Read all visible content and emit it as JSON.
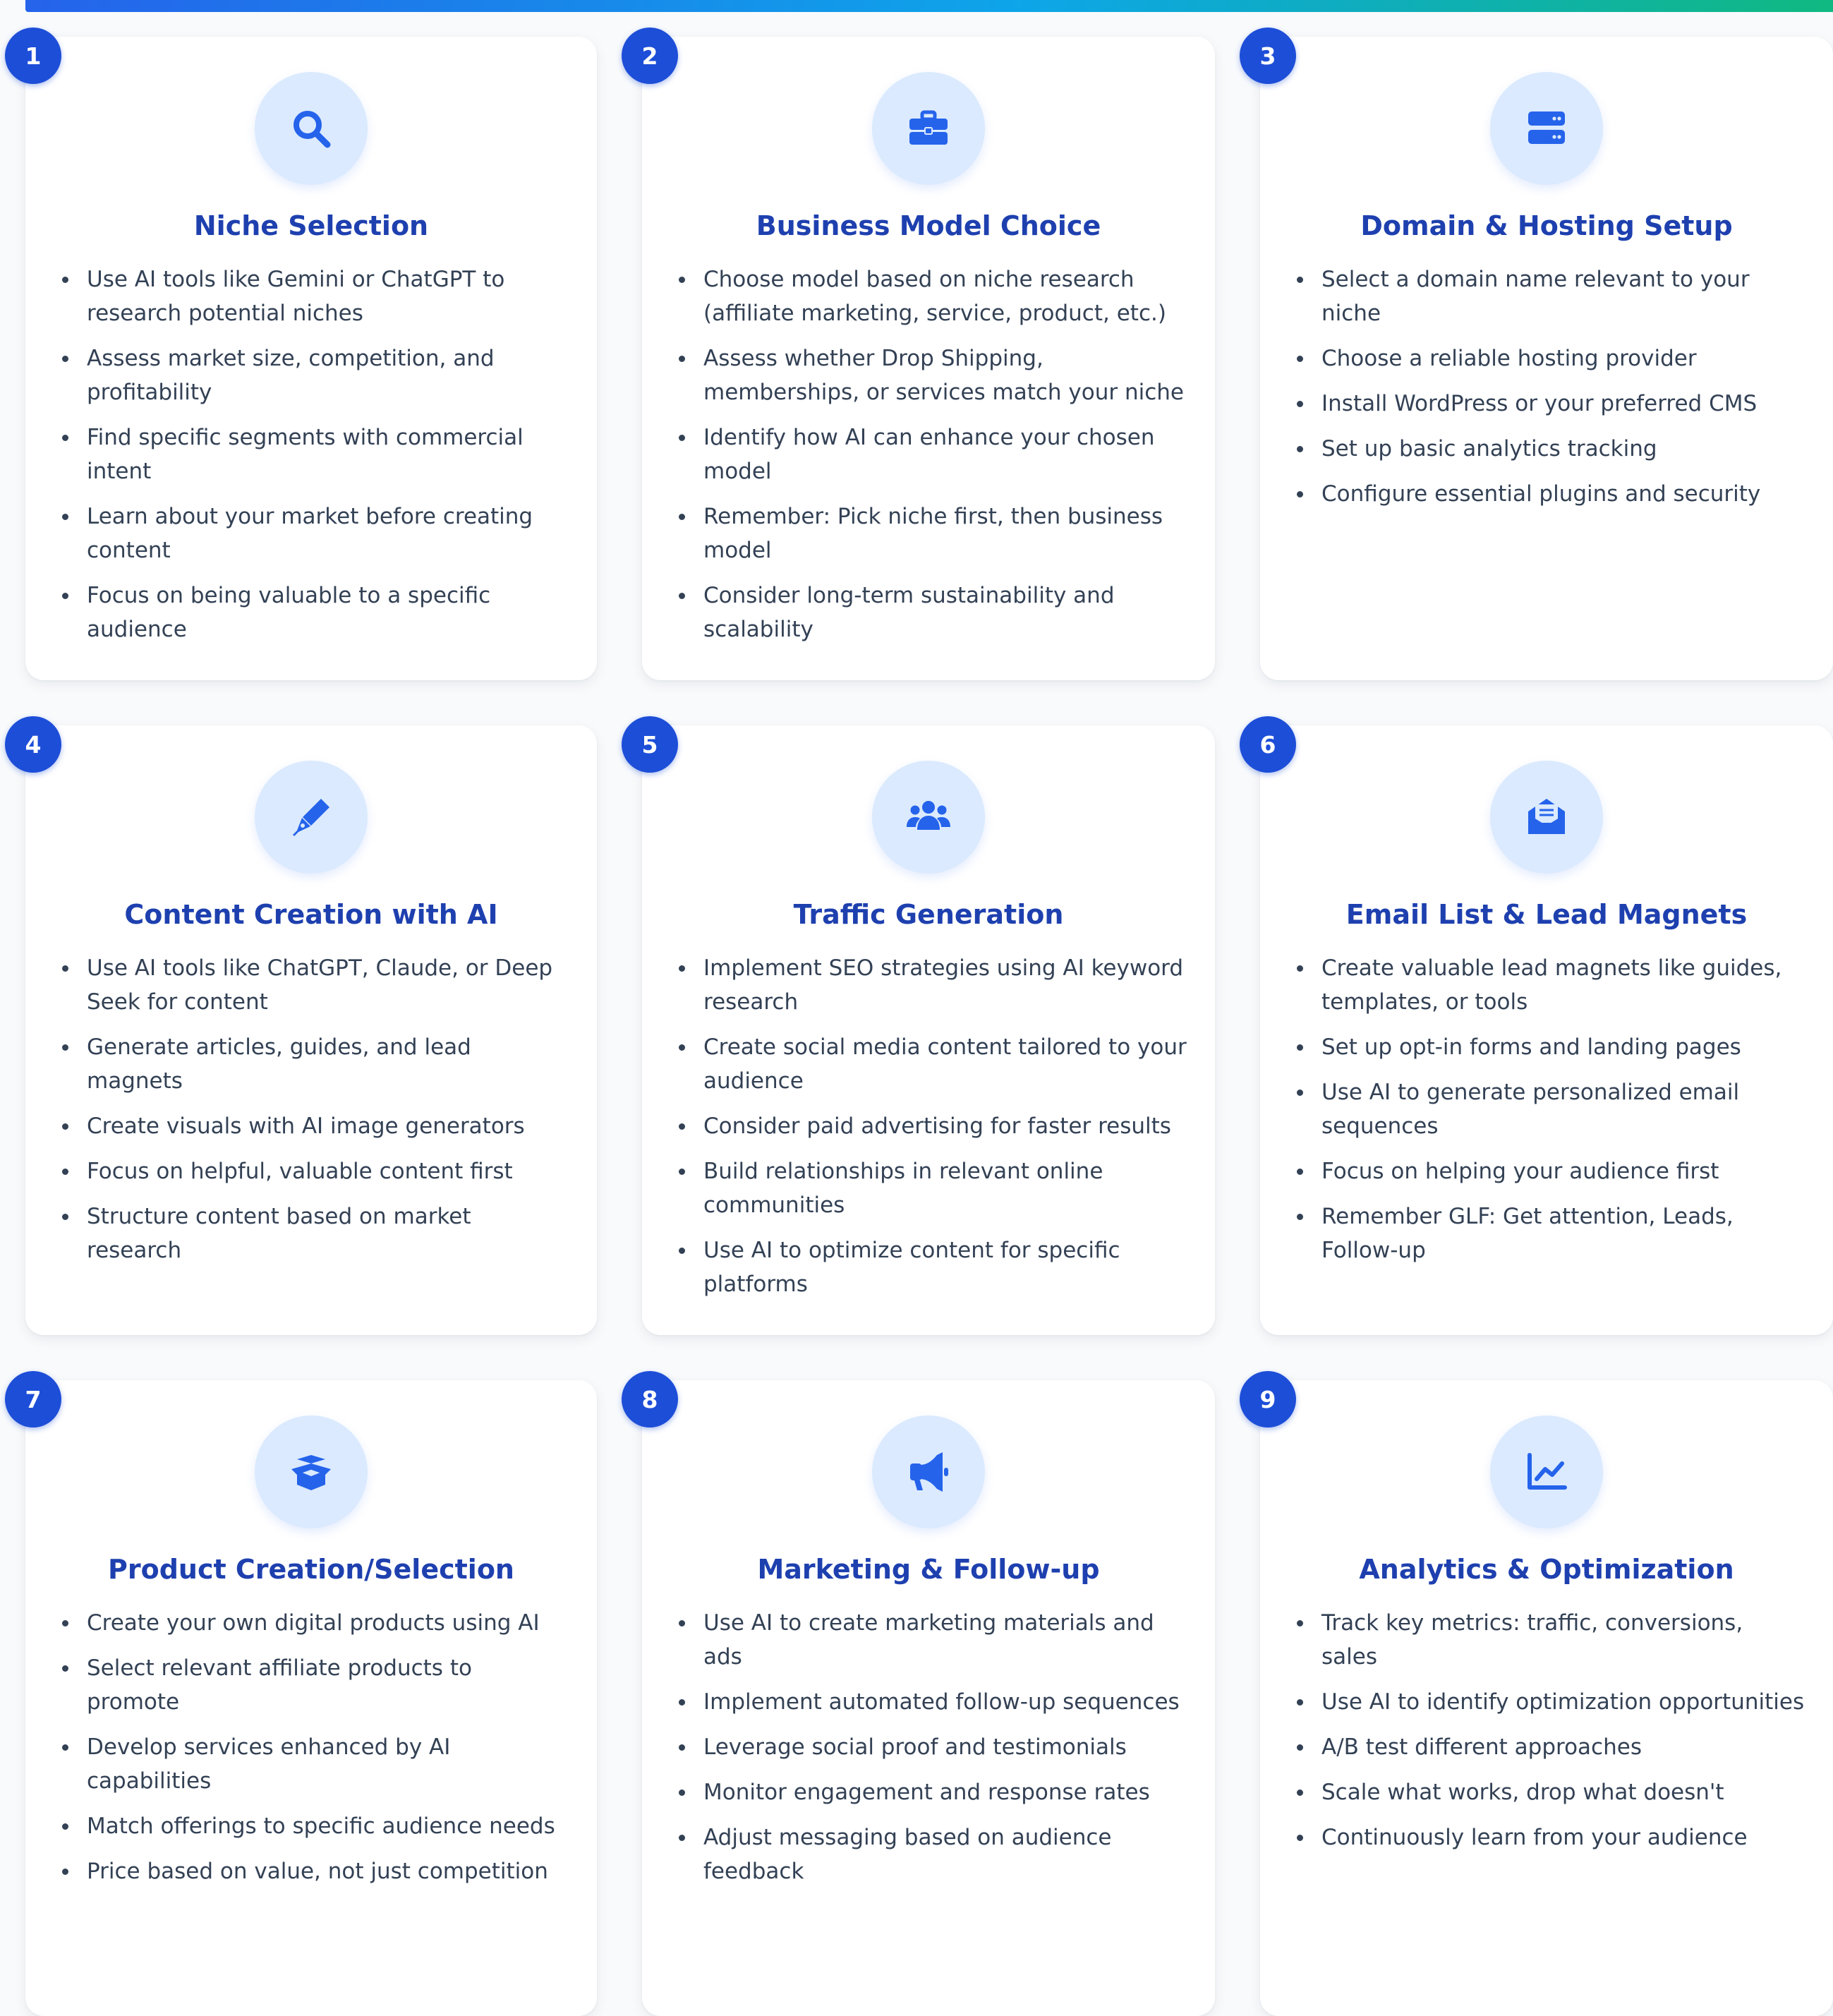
{
  "colors": {
    "accent": "#1d4ed8",
    "title": "#1e40af",
    "icon_bg": "#dbeafe",
    "text": "#334155",
    "background": "#f8fafc",
    "gradient_start": "#2563eb",
    "gradient_end": "#10b981"
  },
  "steps": [
    {
      "number": "1",
      "icon": "search-icon",
      "title": "Niche Selection",
      "points": [
        "Use AI tools like Gemini or ChatGPT to research potential niches",
        "Assess market size, competition, and profitability",
        "Find specific segments with commercial intent",
        "Learn about your market before creating content",
        "Focus on being valuable to a specific audience"
      ]
    },
    {
      "number": "2",
      "icon": "briefcase-icon",
      "title": "Business Model Choice",
      "points": [
        "Choose model based on niche research (affiliate marketing, service, product, etc.)",
        "Assess whether Drop Shipping, memberships, or services match your niche",
        "Identify how AI can enhance your chosen model",
        "Remember: Pick niche first, then business model",
        "Consider long-term sustainability and scalability"
      ]
    },
    {
      "number": "3",
      "icon": "server-icon",
      "title": "Domain & Hosting Setup",
      "points": [
        "Select a domain name relevant to your niche",
        "Choose a reliable hosting provider",
        "Install WordPress or your preferred CMS",
        "Set up basic analytics tracking",
        "Configure essential plugins and security"
      ]
    },
    {
      "number": "4",
      "icon": "pen-nib-icon",
      "title": "Content Creation with AI",
      "points": [
        "Use AI tools like ChatGPT, Claude, or Deep Seek for content",
        "Generate articles, guides, and lead magnets",
        "Create visuals with AI image generators",
        "Focus on helpful, valuable content first",
        "Structure content based on market research"
      ]
    },
    {
      "number": "5",
      "icon": "users-icon",
      "title": "Traffic Generation",
      "points": [
        "Implement SEO strategies using AI keyword research",
        "Create social media content tailored to your audience",
        "Consider paid advertising for faster results",
        "Build relationships in relevant online communities",
        "Use AI to optimize content for specific platforms"
      ]
    },
    {
      "number": "6",
      "icon": "envelope-open-icon",
      "title": "Email List & Lead Magnets",
      "points": [
        "Create valuable lead magnets like guides, templates, or tools",
        "Set up opt-in forms and landing pages",
        "Use AI to generate personalized email sequences",
        "Focus on helping your audience first",
        "Remember GLF: Get attention, Leads, Follow-up"
      ]
    },
    {
      "number": "7",
      "icon": "box-open-icon",
      "title": "Product Creation/Selection",
      "points": [
        "Create your own digital products using AI",
        "Select relevant affiliate products to promote",
        "Develop services enhanced by AI capabilities",
        "Match offerings to specific audience needs",
        "Price based on value, not just competition"
      ]
    },
    {
      "number": "8",
      "icon": "megaphone-icon",
      "title": "Marketing & Follow-up",
      "points": [
        "Use AI to create marketing materials and ads",
        "Implement automated follow-up sequences",
        "Leverage social proof and testimonials",
        "Monitor engagement and response rates",
        "Adjust messaging based on audience feedback"
      ]
    },
    {
      "number": "9",
      "icon": "chart-line-icon",
      "title": "Analytics & Optimization",
      "points": [
        "Track key metrics: traffic, conversions, sales",
        "Use AI to identify optimization opportunities",
        "A/B test different approaches",
        "Scale what works, drop what doesn't",
        "Continuously learn from your audience"
      ]
    }
  ]
}
